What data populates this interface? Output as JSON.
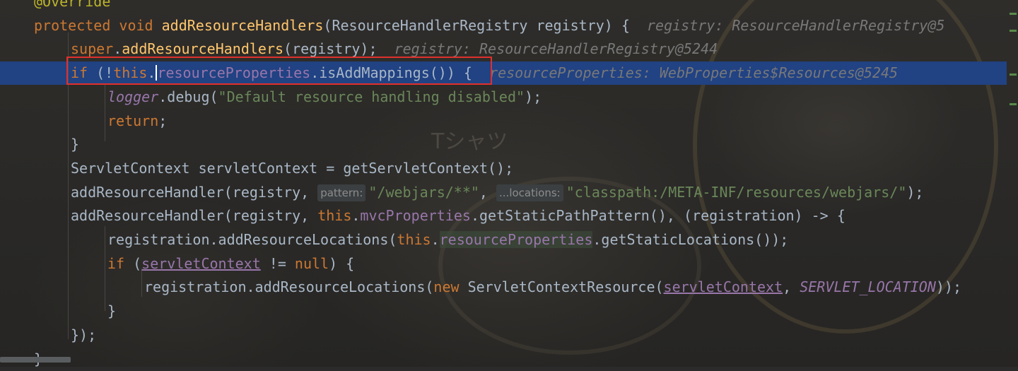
{
  "editor": {
    "lines": [
      {
        "id": "l0",
        "indent": 0,
        "tokens": [
          [
            "ann",
            "@Override"
          ]
        ]
      },
      {
        "id": "l1",
        "indent": 0,
        "tokens": [
          [
            "kw",
            "protected "
          ],
          [
            "kw",
            "void "
          ],
          [
            "fn",
            "addResourceHandlers"
          ],
          [
            "plain",
            "(ResourceHandlerRegistry registry) {  "
          ],
          [
            "inline-val",
            "registry: ResourceHandlerRegistry@5"
          ]
        ]
      },
      {
        "id": "l2",
        "indent": 1,
        "tokens": [
          [
            "kw",
            "super"
          ],
          [
            "plain",
            "."
          ],
          [
            "fn",
            "addResourceHandlers"
          ],
          [
            "plain",
            "(registry);  "
          ],
          [
            "inline-val",
            "registry: ResourceHandlerRegistry@5244"
          ]
        ]
      },
      {
        "id": "l3",
        "indent": 1,
        "current": true,
        "tokens": [
          [
            "kw",
            "if "
          ],
          [
            "plain",
            "(!"
          ],
          [
            "kw",
            "this"
          ],
          [
            "plain",
            "."
          ],
          [
            "caret",
            ""
          ],
          [
            "field",
            "resourceProperties"
          ],
          [
            "plain",
            ".isAddMappings()) {  "
          ],
          [
            "inline-val",
            "resourceProperties: WebProperties$Resources@5245"
          ]
        ]
      },
      {
        "id": "l4",
        "indent": 2,
        "tokens": [
          [
            "field ital",
            "logger"
          ],
          [
            "plain",
            ".debug("
          ],
          [
            "str",
            "\"Default resource handling disabled\""
          ],
          [
            "plain",
            ");"
          ]
        ]
      },
      {
        "id": "l5",
        "indent": 2,
        "tokens": [
          [
            "kw",
            "return"
          ],
          [
            "plain",
            ";"
          ]
        ]
      },
      {
        "id": "l6",
        "indent": 1,
        "tokens": [
          [
            "plain",
            "}"
          ]
        ]
      },
      {
        "id": "l7",
        "indent": 1,
        "tokens": [
          [
            "plain",
            "ServletContext servletContext = getServletContext();"
          ]
        ]
      },
      {
        "id": "l8",
        "indent": 1,
        "tokens": [
          [
            "plain",
            "addResourceHandler(registry, "
          ],
          [
            "hint",
            "pattern:"
          ],
          [
            "str",
            "\"/webjars/**\""
          ],
          [
            "plain",
            ", "
          ],
          [
            "hint",
            "...locations:"
          ],
          [
            "str",
            "\"classpath:/META-INF/resources/webjars/\""
          ],
          [
            "plain",
            ");"
          ]
        ]
      },
      {
        "id": "l9",
        "indent": 1,
        "tokens": [
          [
            "plain",
            "addResourceHandler(registry, "
          ],
          [
            "kw",
            "this"
          ],
          [
            "plain",
            "."
          ],
          [
            "field",
            "mvcProperties"
          ],
          [
            "plain",
            ".getStaticPathPattern(), (registration) -> {"
          ]
        ]
      },
      {
        "id": "l10",
        "indent": 2,
        "tokens": [
          [
            "plain",
            "registration.addResourceLocations("
          ],
          [
            "kw",
            "this"
          ],
          [
            "plain",
            "."
          ],
          [
            "field hl",
            "resourceProperties"
          ],
          [
            "plain",
            ".getStaticLocations());"
          ]
        ]
      },
      {
        "id": "l11",
        "indent": 2,
        "tokens": [
          [
            "kw",
            "if "
          ],
          [
            "plain",
            "("
          ],
          [
            "param-ul",
            "servletContext"
          ],
          [
            "plain",
            " != "
          ],
          [
            "kw",
            "null"
          ],
          [
            "plain",
            ") {"
          ]
        ]
      },
      {
        "id": "l12",
        "indent": 3,
        "tokens": [
          [
            "plain",
            "registration.addResourceLocations("
          ],
          [
            "kw",
            "new "
          ],
          [
            "plain",
            "ServletContextResource("
          ],
          [
            "param-ul",
            "servletContext"
          ],
          [
            "plain",
            ", "
          ],
          [
            "field ital",
            "SERVLET_LOCATION"
          ],
          [
            "plain",
            "));"
          ]
        ]
      },
      {
        "id": "l13",
        "indent": 2,
        "tokens": [
          [
            "plain",
            "}"
          ]
        ]
      },
      {
        "id": "l14",
        "indent": 1,
        "tokens": [
          [
            "plain",
            "});"
          ]
        ]
      },
      {
        "id": "l15",
        "indent": 0,
        "tokens": [
          [
            "plain",
            "}"
          ]
        ]
      }
    ]
  },
  "background": {
    "watermark_text": "Tシャツ"
  },
  "colors": {
    "current_line": "#214283",
    "highlight_box": "#e0302c",
    "keyword": "#cc7832",
    "field": "#9876aa",
    "string": "#6a8759",
    "function": "#ffc66d"
  }
}
